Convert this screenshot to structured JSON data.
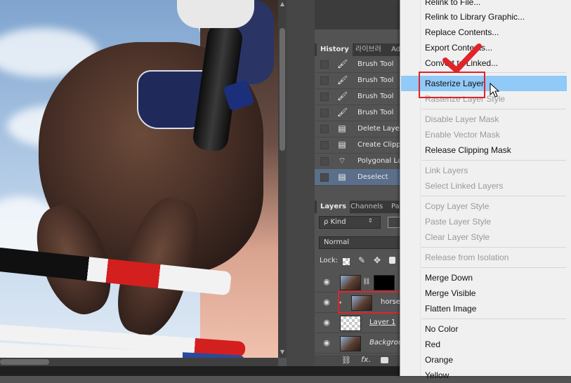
{
  "history": {
    "tabs": [
      "History",
      "라이브러",
      "Ad"
    ],
    "steps": [
      {
        "label": "Brush Tool",
        "icon": "brush-icon"
      },
      {
        "label": "Brush Tool",
        "icon": "brush-icon"
      },
      {
        "label": "Brush Tool",
        "icon": "brush-icon"
      },
      {
        "label": "Brush Tool",
        "icon": "brush-icon"
      },
      {
        "label": "Delete Layer",
        "icon": "document-icon"
      },
      {
        "label": "Create Clippin",
        "icon": "document-icon"
      },
      {
        "label": "Polygonal Las",
        "icon": "polygonal-lasso-icon"
      },
      {
        "label": "Deselect",
        "icon": "document-icon"
      }
    ]
  },
  "layers": {
    "tabs": [
      "Layers",
      "Channels",
      "Pa"
    ],
    "filter_kind": "ρ Kind",
    "blend_mode": "Normal",
    "lock_label": "Lock:",
    "items": [
      {
        "name": "",
        "thumb": "photo-with-mask"
      },
      {
        "name": "horse",
        "thumb": "smart-object"
      },
      {
        "name": "Layer 1",
        "thumb": "transparent"
      },
      {
        "name": "Backgrou",
        "thumb": "photo"
      }
    ],
    "footer_icons": [
      "link-icon",
      "fx-icon",
      "mask-icon"
    ]
  },
  "context_menu": {
    "items": [
      {
        "label": "Relink to File...",
        "enabled": true
      },
      {
        "label": "Relink to Library Graphic...",
        "enabled": true
      },
      {
        "label": "Replace Contents...",
        "enabled": true
      },
      {
        "label": "Export Contents...",
        "enabled": true
      },
      {
        "label": "Convert to Linked...",
        "enabled": true
      },
      {
        "label": "Rasterize Layer",
        "enabled": true,
        "hovered": true
      },
      {
        "label": "Rasterize Layer Style",
        "enabled": false
      },
      {
        "label": "Disable Layer Mask",
        "enabled": false
      },
      {
        "label": "Enable Vector Mask",
        "enabled": false
      },
      {
        "label": "Release Clipping Mask",
        "enabled": true
      },
      {
        "label": "Link Layers",
        "enabled": false
      },
      {
        "label": "Select Linked Layers",
        "enabled": false
      },
      {
        "label": "Copy Layer Style",
        "enabled": false
      },
      {
        "label": "Paste Layer Style",
        "enabled": false
      },
      {
        "label": "Clear Layer Style",
        "enabled": false
      },
      {
        "label": "Release from Isolation",
        "enabled": false
      },
      {
        "label": "Merge Down",
        "enabled": true
      },
      {
        "label": "Merge Visible",
        "enabled": true
      },
      {
        "label": "Flatten Image",
        "enabled": true
      },
      {
        "label": "No Color",
        "enabled": true
      },
      {
        "label": "Red",
        "enabled": true
      },
      {
        "label": "Orange",
        "enabled": true
      },
      {
        "label": "Yellow",
        "enabled": true
      }
    ]
  },
  "colors": {
    "highlight_box": "#e0242a",
    "menu_hover": "#91c9f7",
    "history_selected": "#5b6e8a"
  }
}
